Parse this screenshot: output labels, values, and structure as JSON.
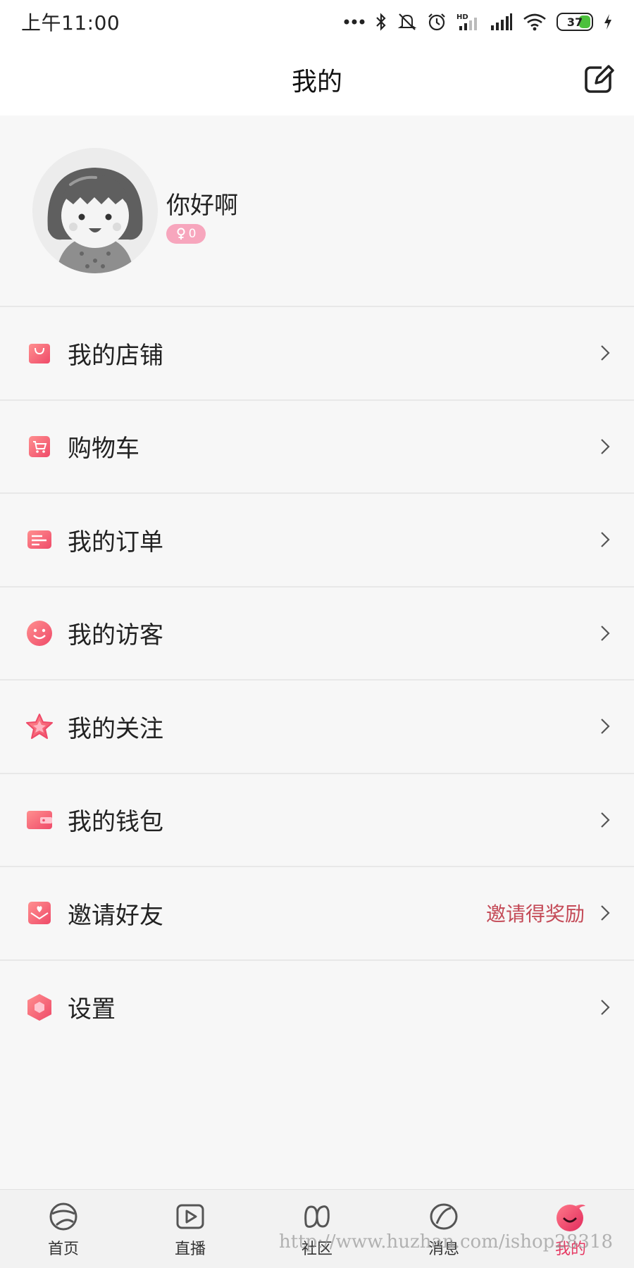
{
  "status_bar": {
    "time": "上午11:00",
    "battery": "37",
    "icons": [
      "more-dots-icon",
      "bluetooth-icon",
      "mute-icon",
      "alarm-icon",
      "hd-signal-icon",
      "signal-icon",
      "wifi-icon",
      "battery-icon",
      "charging-icon"
    ]
  },
  "header": {
    "title": "我的",
    "edit_icon": "edit-icon"
  },
  "profile": {
    "username": "你好啊",
    "badge_count": "0",
    "badge_icon": "female-icon"
  },
  "menu": {
    "items": [
      {
        "label": "我的店铺",
        "icon": "shop-bag-icon"
      },
      {
        "label": "购物车",
        "icon": "cart-icon"
      },
      {
        "label": "我的订单",
        "icon": "order-icon"
      },
      {
        "label": "我的访客",
        "icon": "smile-icon"
      },
      {
        "label": "我的关注",
        "icon": "star-icon"
      },
      {
        "label": "我的钱包",
        "icon": "wallet-icon"
      },
      {
        "label": "邀请好友",
        "icon": "invite-envelope-icon",
        "extra": "邀请得奖励"
      },
      {
        "label": "设置",
        "icon": "settings-hexagon-icon"
      }
    ]
  },
  "bottom_nav": {
    "items": [
      {
        "label": "首页",
        "icon": "home-swirl-icon"
      },
      {
        "label": "直播",
        "icon": "live-play-icon"
      },
      {
        "label": "社区",
        "icon": "community-loop-icon"
      },
      {
        "label": "消息",
        "icon": "message-icon"
      },
      {
        "label": "我的",
        "icon": "profile-flame-icon",
        "active": true
      }
    ]
  },
  "watermark": "http://www.huzhan.com/ishop28318",
  "colors": {
    "accent": "#e63b64",
    "icon_gradient_start": "#ff8a8a",
    "icon_gradient_end": "#f0506a",
    "extra_text": "#c44a57",
    "badge": "#f7a6bd"
  }
}
